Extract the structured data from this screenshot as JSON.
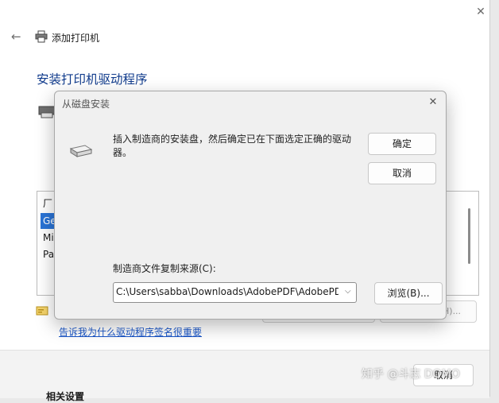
{
  "wizard": {
    "title": "添加打印机",
    "heading": "安装打印机驱动程序",
    "list_items": [
      "厂",
      "Ge",
      "Mi",
      "Pa"
    ],
    "link": "告诉我为什么驱动程序签名很重要",
    "footer_button": "取消",
    "footer_text": "相关设置",
    "partial_button": "H)..."
  },
  "dialog": {
    "title": "从磁盘安装",
    "message": "插入制造商的安装盘，然后确定已在下面选定正确的驱动器。",
    "ok_label": "确定",
    "cancel_label": "取消",
    "source_label": "制造商文件复制来源(C):",
    "source_value": "C:\\Users\\sabba\\Downloads\\AdobePDF\\AdobePDF",
    "browse_label": "浏览(B)..."
  },
  "watermark": "知乎 @斗志 DOMO"
}
